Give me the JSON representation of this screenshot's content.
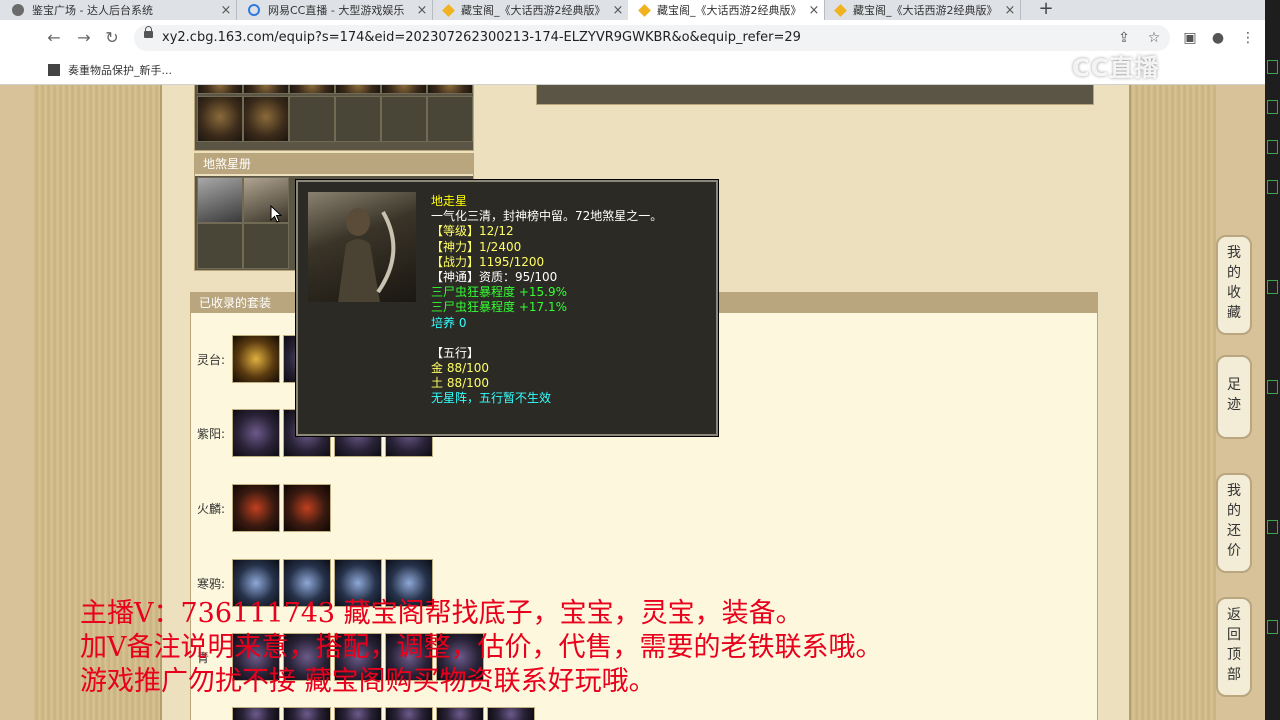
{
  "browser": {
    "tabs": [
      {
        "label": "鉴宝广场 - 达人后台系统",
        "active": false
      },
      {
        "label": "网易CC直播 - 大型游戏娱乐",
        "active": false
      },
      {
        "label": "藏宝阁_《大话西游2经典版》",
        "active": false
      },
      {
        "label": "藏宝阁_《大话西游2经典版》",
        "active": true
      },
      {
        "label": "藏宝阁_《大话西游2经典版》",
        "active": false
      }
    ],
    "new_tab": "+",
    "url": "xy2.cbg.163.com/equip?s=174&eid=202307262300213-174-ELZYVR9GWKBR&o&equip_refer=29",
    "bookmark": "奏重物品保护_新手..."
  },
  "watermark": "CC直播",
  "page": {
    "star_panel_title": "地煞星册",
    "set_panel_title": "已收录的套装",
    "set_rows": [
      {
        "label": "灵台:",
        "icons": 2
      },
      {
        "label": "紫阳:",
        "icons": 4
      },
      {
        "label": "火麟:",
        "icons": 2
      },
      {
        "label": "寒鸦:",
        "icons": 4
      },
      {
        "label": "青",
        "icons": 5
      }
    ],
    "side_buttons": [
      "我的收藏",
      "足迹",
      "我的还价",
      "返回顶部"
    ]
  },
  "tooltip": {
    "name": "地走星",
    "desc": "一气化三清，封神榜中留。72地煞星之一。",
    "level": "【等级】12/12",
    "power": "【神力】1/2400",
    "combat": "【战力】1195/1200",
    "talent": "【神通】资质：95/100",
    "bonus1": "三尸虫狂暴程度 +15.9%",
    "bonus2": "三尸虫狂暴程度 +17.1%",
    "cultivate": "培养 0",
    "wuxing_title": "【五行】",
    "metal": "金 88/100",
    "earth": "土 88/100",
    "wuxing_note": "无星阵，五行暂不生效",
    "colors": {
      "name": "#ffff00",
      "white": "#ffffff",
      "yellow": "#ffff66",
      "green": "#33ff33",
      "cyan": "#33ffff"
    }
  },
  "overlay": {
    "line1": "主播V：736111743        藏宝阁帮找底子，宝宝，灵宝，装备。",
    "line2": "加V备注说明来意，搭配，调整，估价，代售，需要的老铁联系哦。",
    "line3": "游戏推广勿扰不接            藏宝阁购买物资联系好玩哦。"
  }
}
